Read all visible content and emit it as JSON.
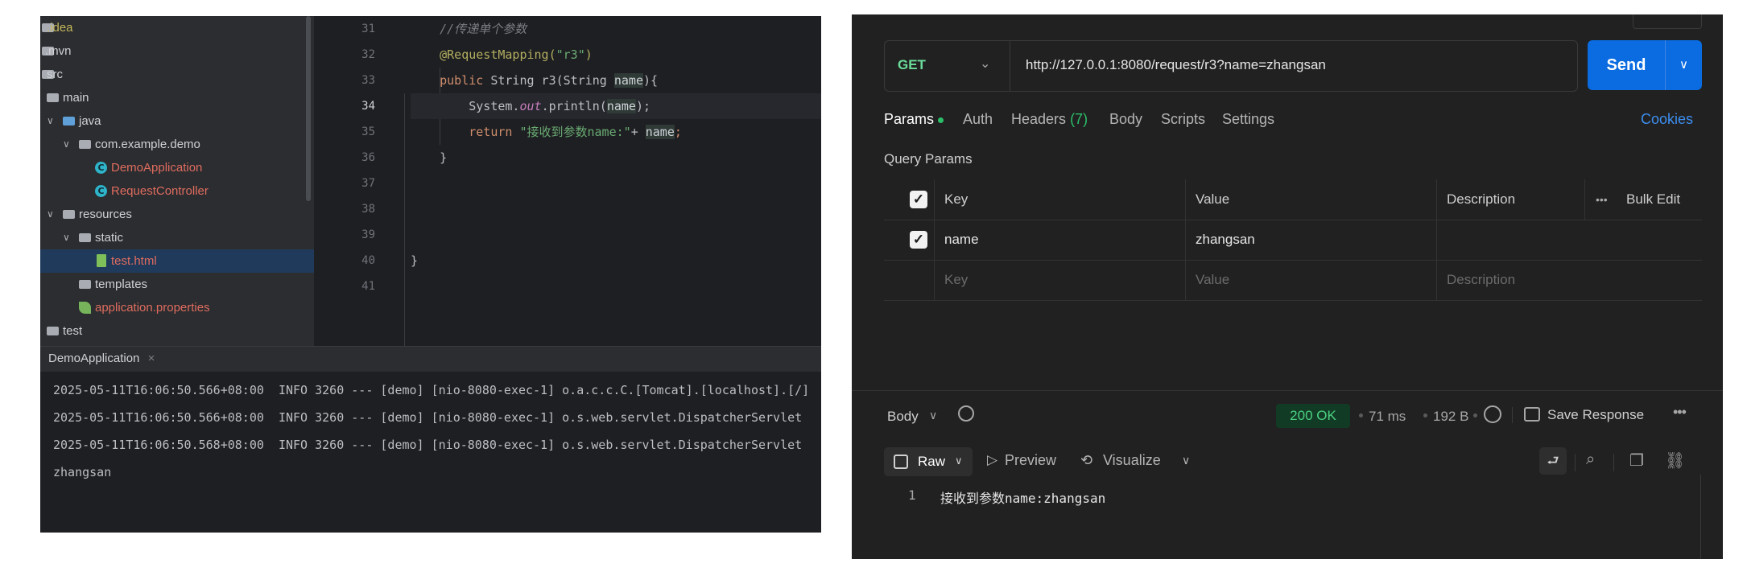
{
  "ide": {
    "tree": [
      {
        "label": ".idea",
        "kind": "folder",
        "color": "yellow"
      },
      {
        "label": ".mvn",
        "kind": "folder"
      },
      {
        "label": "src",
        "kind": "folder"
      },
      {
        "label": "main",
        "kind": "folder"
      },
      {
        "label": "java",
        "kind": "folder-source"
      },
      {
        "label": "com.example.demo",
        "kind": "package"
      },
      {
        "label": "DemoApplication",
        "kind": "class",
        "color": "red"
      },
      {
        "label": "RequestController",
        "kind": "class",
        "color": "red"
      },
      {
        "label": "resources",
        "kind": "folder-resources"
      },
      {
        "label": "static",
        "kind": "folder"
      },
      {
        "label": "test.html",
        "kind": "html",
        "color": "red",
        "selected": true
      },
      {
        "label": "templates",
        "kind": "folder"
      },
      {
        "label": "application.properties",
        "kind": "properties",
        "color": "red"
      },
      {
        "label": "test",
        "kind": "folder"
      }
    ],
    "line_numbers": [
      "31",
      "32",
      "33",
      "34",
      "35",
      "36",
      "37",
      "38",
      "39",
      "40",
      "41"
    ],
    "code": {
      "comment": "//传递单个参数",
      "annotation": "@RequestMapping(",
      "mapping_value": "\"r3\"",
      "annotation_close": ")",
      "kw_public": "public",
      "signature": " String r3(String ",
      "param": "name",
      "sig_close": "){",
      "sys": "System.",
      "out": "out",
      "println": ".println(",
      "arg": "name",
      "println_close": ");",
      "kw_return": "return",
      "ret_string": " \"接收到参数name:\"",
      "plus": "+ ",
      "ret_var": "name",
      "semi": ";",
      "close_method": "}",
      "close_class": "}"
    },
    "run_tab": "DemoApplication",
    "run_tab_close": "×",
    "console": [
      "2025-05-11T16:06:50.566+08:00  INFO 3260 --- [demo] [nio-8080-exec-1] o.a.c.c.C.[Tomcat].[localhost].[/]",
      "2025-05-11T16:06:50.566+08:00  INFO 3260 --- [demo] [nio-8080-exec-1] o.s.web.servlet.DispatcherServlet",
      "2025-05-11T16:06:50.568+08:00  INFO 3260 --- [demo] [nio-8080-exec-1] o.s.web.servlet.DispatcherServlet",
      "zhangsan"
    ]
  },
  "api": {
    "method": "GET",
    "url": "http://127.0.0.1:8080/request/r3?name=zhangsan",
    "send": "Send",
    "tabs": {
      "params": "Params",
      "auth": "Auth",
      "headers": "Headers",
      "headers_count": "(7)",
      "body": "Body",
      "scripts": "Scripts",
      "settings": "Settings"
    },
    "cookies": "Cookies",
    "query_params_title": "Query Params",
    "columns": {
      "key": "Key",
      "value": "Value",
      "description": "Description",
      "bulk_edit": "Bulk Edit"
    },
    "row": {
      "key": "name",
      "value": "zhangsan",
      "checked": true
    },
    "placeholders": {
      "key": "Key",
      "value": "Value",
      "description": "Description"
    },
    "response": {
      "body_label": "Body",
      "status": "200 OK",
      "time": "71 ms",
      "size": "192 B",
      "save_response": "Save Response",
      "raw": "Raw",
      "preview": "Preview",
      "visualize": "Visualize",
      "line_number": "1",
      "content": "接收到参数name:zhangsan"
    },
    "colors": {
      "accent": "#0b6be0",
      "method": "#6bdd9a",
      "status_ok": "#4ccf82",
      "link": "#3d8ef0"
    }
  }
}
